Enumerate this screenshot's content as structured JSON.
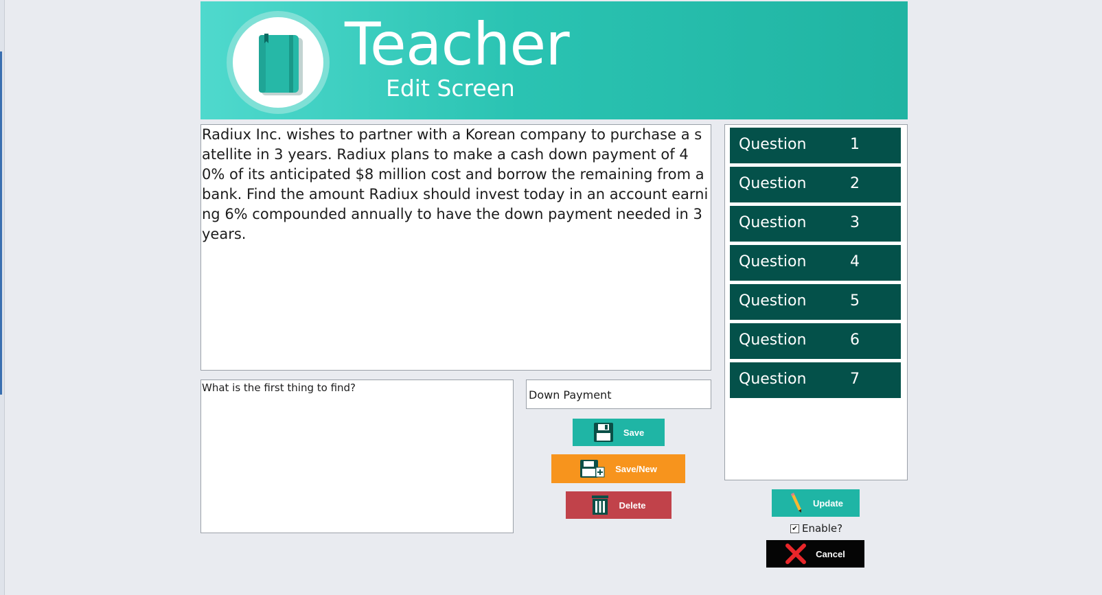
{
  "banner": {
    "title": "Teacher",
    "subtitle": "Edit Screen",
    "icon": "notebook-icon"
  },
  "question_text": "Radiux Inc. wishes to partner with a Korean company to purchase a satellite in 3 years. Radiux plans to make a cash down payment of 40% of its anticipated $8 million cost and borrow the remaining from a bank. Find the amount Radiux should invest today in an account earning 6% compounded annually to have the down payment needed in 3 years.",
  "step_prompt": "What is the first thing to find?",
  "answer_value": "Down Payment",
  "buttons": {
    "save": "Save",
    "save_new": "Save/New",
    "delete": "Delete",
    "update": "Update",
    "cancel": "Cancel"
  },
  "questions": [
    {
      "label": "Question",
      "number": "1"
    },
    {
      "label": "Question",
      "number": "2"
    },
    {
      "label": "Question",
      "number": "3"
    },
    {
      "label": "Question",
      "number": "4"
    },
    {
      "label": "Question",
      "number": "5"
    },
    {
      "label": "Question",
      "number": "6"
    },
    {
      "label": "Question",
      "number": "7"
    }
  ],
  "enable": {
    "label": "Enable?",
    "checked": true
  },
  "colors": {
    "teal": "#1fb5a5",
    "dark_teal": "#04514a",
    "orange": "#f7941d",
    "red": "#c1424a",
    "black": "#050505"
  }
}
